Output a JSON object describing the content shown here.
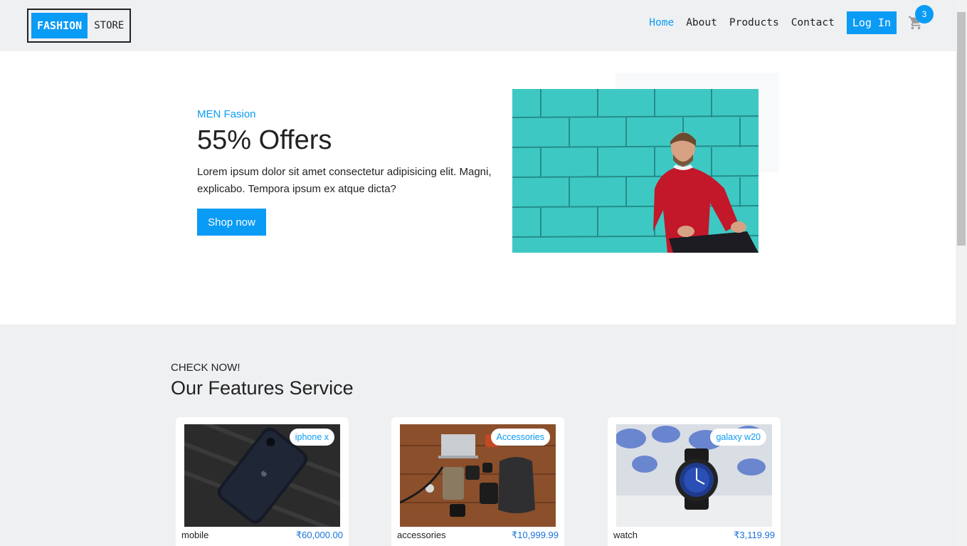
{
  "header": {
    "logo_brand": "FASHION",
    "logo_store": "STORE",
    "nav": [
      "Home",
      "About",
      "Products",
      "Contact"
    ],
    "login_label": "Log In",
    "cart_count": "3",
    "accent_color": "#0a9bf5"
  },
  "hero": {
    "subtitle": "MEN Fasion",
    "headline": "55% Offers",
    "description": "Lorem ipsum dolor sit amet consectetur adipisicing elit. Magni, explicabo. Tempora ipsum ex atque dicta?",
    "cta_label": "Shop now"
  },
  "features": {
    "kicker": "CHECK NOW!",
    "title": "Our Features Service",
    "cards": [
      {
        "tag": "iphone x",
        "name": "mobile",
        "price": "₹60,000.00"
      },
      {
        "tag": "Accessories",
        "name": "accessories",
        "price": "₹10,999.99"
      },
      {
        "tag": "galaxy w20",
        "name": "watch",
        "price": "₹3,119.99"
      }
    ]
  }
}
